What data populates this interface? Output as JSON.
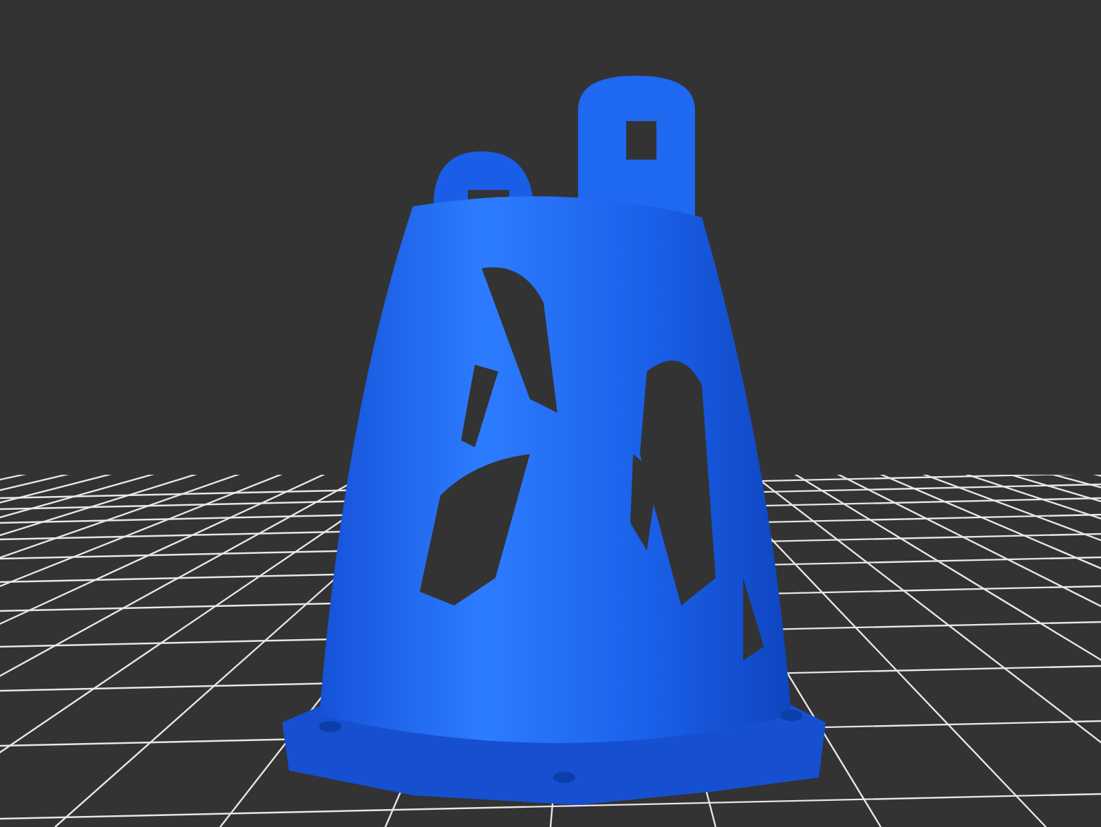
{
  "viewport": {
    "kind": "perspective",
    "model": {
      "kind": "lattice"
    }
  }
}
